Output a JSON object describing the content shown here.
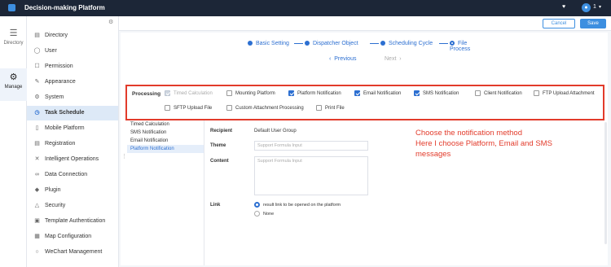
{
  "topbar": {
    "title": "Decision-making Platform",
    "user_label": "1"
  },
  "icon_rail": [
    {
      "label": "Directory",
      "icon": "list-icon"
    },
    {
      "label": "Manage",
      "icon": "gear-icon"
    }
  ],
  "sidebar": {
    "items": [
      {
        "label": "Directory",
        "icon": "folder-icon"
      },
      {
        "label": "User",
        "icon": "user-icon"
      },
      {
        "label": "Permission",
        "icon": "lock-icon"
      },
      {
        "label": "Appearance",
        "icon": "brush-icon"
      },
      {
        "label": "System",
        "icon": "settings-icon"
      },
      {
        "label": "Task Schedule",
        "icon": "clock-icon"
      },
      {
        "label": "Mobile Platform",
        "icon": "mobile-icon"
      },
      {
        "label": "Registration",
        "icon": "registration-icon"
      },
      {
        "label": "Intelligent Operations",
        "icon": "operations-icon"
      },
      {
        "label": "Data Connection",
        "icon": "link-icon"
      },
      {
        "label": "Plugin",
        "icon": "plugin-icon"
      },
      {
        "label": "Security",
        "icon": "shield-icon"
      },
      {
        "label": "Template Authentication",
        "icon": "template-icon"
      },
      {
        "label": "Map Configuration",
        "icon": "map-icon"
      },
      {
        "label": "WeChart Management",
        "icon": "chat-icon"
      }
    ],
    "active": "Task Schedule"
  },
  "header": {
    "cancel": "Cancel",
    "save": "Save"
  },
  "steps": [
    {
      "label": "Basic Setting"
    },
    {
      "label": "Dispatcher Object"
    },
    {
      "label": "Scheduling Cycle"
    },
    {
      "label": "File Process"
    }
  ],
  "nav": {
    "previous": "Previous",
    "next": "Next"
  },
  "processing": {
    "label": "Processing",
    "options": [
      {
        "label": "Timed Calculation",
        "checked": true,
        "disabled": true
      },
      {
        "label": "Mounting Platform",
        "checked": false
      },
      {
        "label": "Platform Notification",
        "checked": true
      },
      {
        "label": "Email Notification",
        "checked": true
      },
      {
        "label": "SMS Notification",
        "checked": true
      },
      {
        "label": "Client Notification",
        "checked": false
      },
      {
        "label": "FTP Upload Attachment",
        "checked": false
      },
      {
        "label": "SFTP Upload File",
        "checked": false
      },
      {
        "label": "Custom Attachment Processing",
        "checked": false
      },
      {
        "label": "Print File",
        "checked": false
      }
    ]
  },
  "left_list": {
    "items": [
      "Timed Calculation",
      "SMS Notification",
      "Email Notification",
      "Platform Notification"
    ],
    "selected": "Platform Notification"
  },
  "form": {
    "recipient_label": "Recipient",
    "recipient_value": "Default User Group",
    "theme_label": "Theme",
    "theme_placeholder": "Support Formula Input",
    "content_label": "Content",
    "content_placeholder": "Support Formula Input",
    "link_label": "Link",
    "link_options": [
      "result link to be opened on the platform",
      "None"
    ]
  },
  "annotation": {
    "line1": "Choose the notification method",
    "line2": "Here I choose Platform, Email and SMS",
    "line3": "messages"
  },
  "colors": {
    "accent": "#2c6fd1",
    "highlight": "#e23b2b",
    "topbar": "#1c2637"
  }
}
